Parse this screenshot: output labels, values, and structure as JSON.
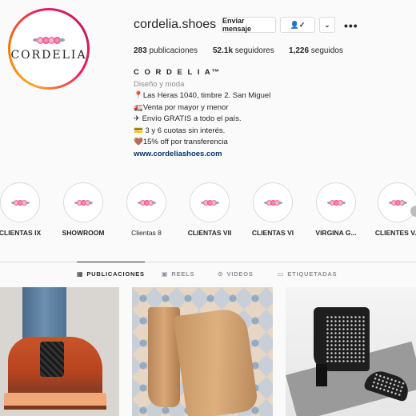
{
  "profile": {
    "username": "cordelia.shoes",
    "logo_text": "CORDELIA",
    "buttons": {
      "message": "Enviar mensaje",
      "follow_icon": "person-check-icon",
      "dropdown_icon": "chevron-down-icon",
      "more_icon": "more-icon"
    },
    "stats": {
      "posts": "283",
      "posts_label": " publicaciones",
      "followers": "52.1k",
      "followers_label": " seguidores",
      "following": "1,226",
      "following_label": " seguidos"
    },
    "bio": {
      "name": "C O R D E L I A™",
      "category": "Diseño y moda",
      "lines": [
        "📍Las Heras 1040, timbre 2. San Miguel",
        "🚛Venta por mayor y menor",
        "✈ Envío GRATIS a todo el país.",
        "💳 3 y 6 cuotas sin interés.",
        "🤎15% off por transferencia"
      ],
      "link": "www.cordeliashoes.com"
    }
  },
  "highlights": [
    {
      "label": "CLIENTAS IX"
    },
    {
      "label": "SHOWROOM"
    },
    {
      "label": "Clientas 8"
    },
    {
      "label": "CLIENTAS VII"
    },
    {
      "label": "CLIENTAS VI"
    },
    {
      "label": "VIRGINA G..."
    },
    {
      "label": "CLIENTES V..."
    }
  ],
  "tabs": [
    {
      "label": "PUBLICACIONES",
      "icon": "grid-icon",
      "active": true
    },
    {
      "label": "REELS",
      "icon": "reels-icon"
    },
    {
      "label": "VIDEOS",
      "icon": "video-icon"
    },
    {
      "label": "ETIQUETADAS",
      "icon": "tag-icon"
    }
  ],
  "colors": {
    "accent_link": "#00376b",
    "ring_start": "#f9a825",
    "ring_end": "#e91e63",
    "background": "#fafafa"
  }
}
